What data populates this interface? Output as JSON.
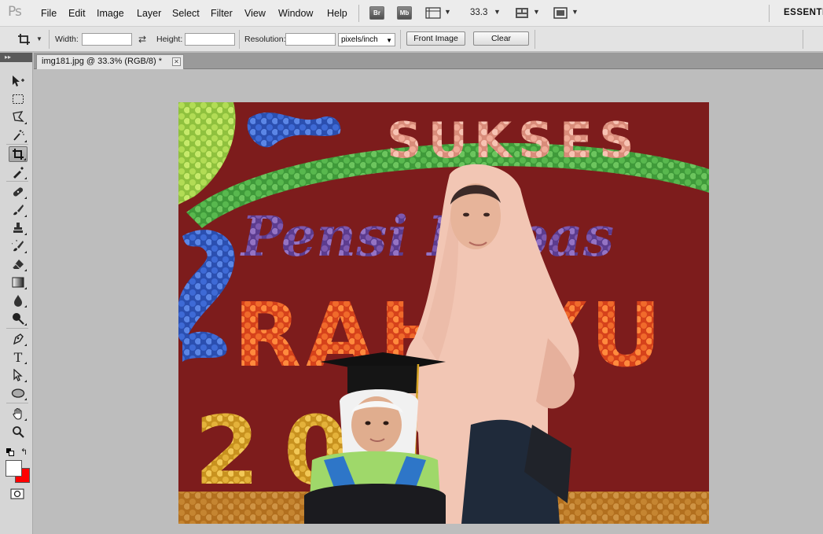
{
  "app": {
    "logo": "Ps",
    "workspace": "ESSENTI"
  },
  "menu": {
    "items": [
      "File",
      "Edit",
      "Image",
      "Layer",
      "Select",
      "Filter",
      "View",
      "Window",
      "Help"
    ]
  },
  "appbar": {
    "bridge_label": "Br",
    "minibridge_label": "Mb",
    "zoom_value": "33.3"
  },
  "options": {
    "width_label": "Width:",
    "height_label": "Height:",
    "resolution_label": "Resolution:",
    "units_value": "pixels/inch",
    "front_image_label": "Front Image",
    "clear_label": "Clear"
  },
  "document": {
    "tab_title": "img181.jpg @ 33.3% (RGB/8) *"
  },
  "tools_panel": {
    "header": "▸▸"
  },
  "colors": {
    "foreground": "#ffffff",
    "background": "#ff0000",
    "accent": "#e3e3e3"
  },
  "canvas_art": {
    "top_text": "SUKSES",
    "script_text": "Pensi Kepas",
    "main_text": "RAHAYU",
    "year_text": "2019"
  }
}
